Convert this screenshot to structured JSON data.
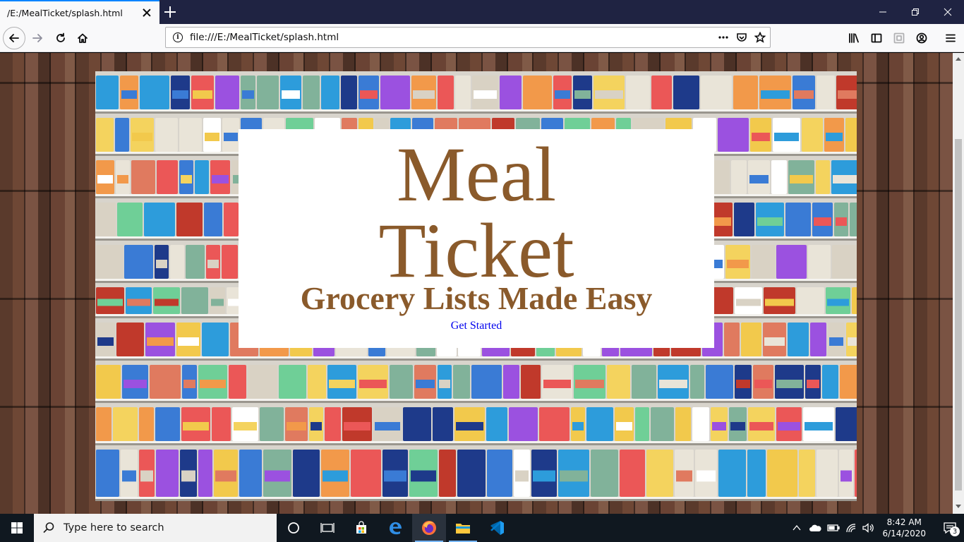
{
  "browser": {
    "tab_title": "/E:/MealTicket/splash.html",
    "url": "file:///E:/MealTicket/splash.html"
  },
  "page": {
    "title_line1": "Meal",
    "title_line2": "Ticket",
    "tagline": "Grocery Lists Made Easy",
    "cta": "Get Started",
    "colors": {
      "title": "#8a5a2b",
      "link": "#0000ee",
      "card": "#ffffff"
    }
  },
  "taskbar": {
    "search_placeholder": "Type here to search",
    "time": "8:42 AM",
    "date": "6/14/2020",
    "notification_count": "3"
  }
}
